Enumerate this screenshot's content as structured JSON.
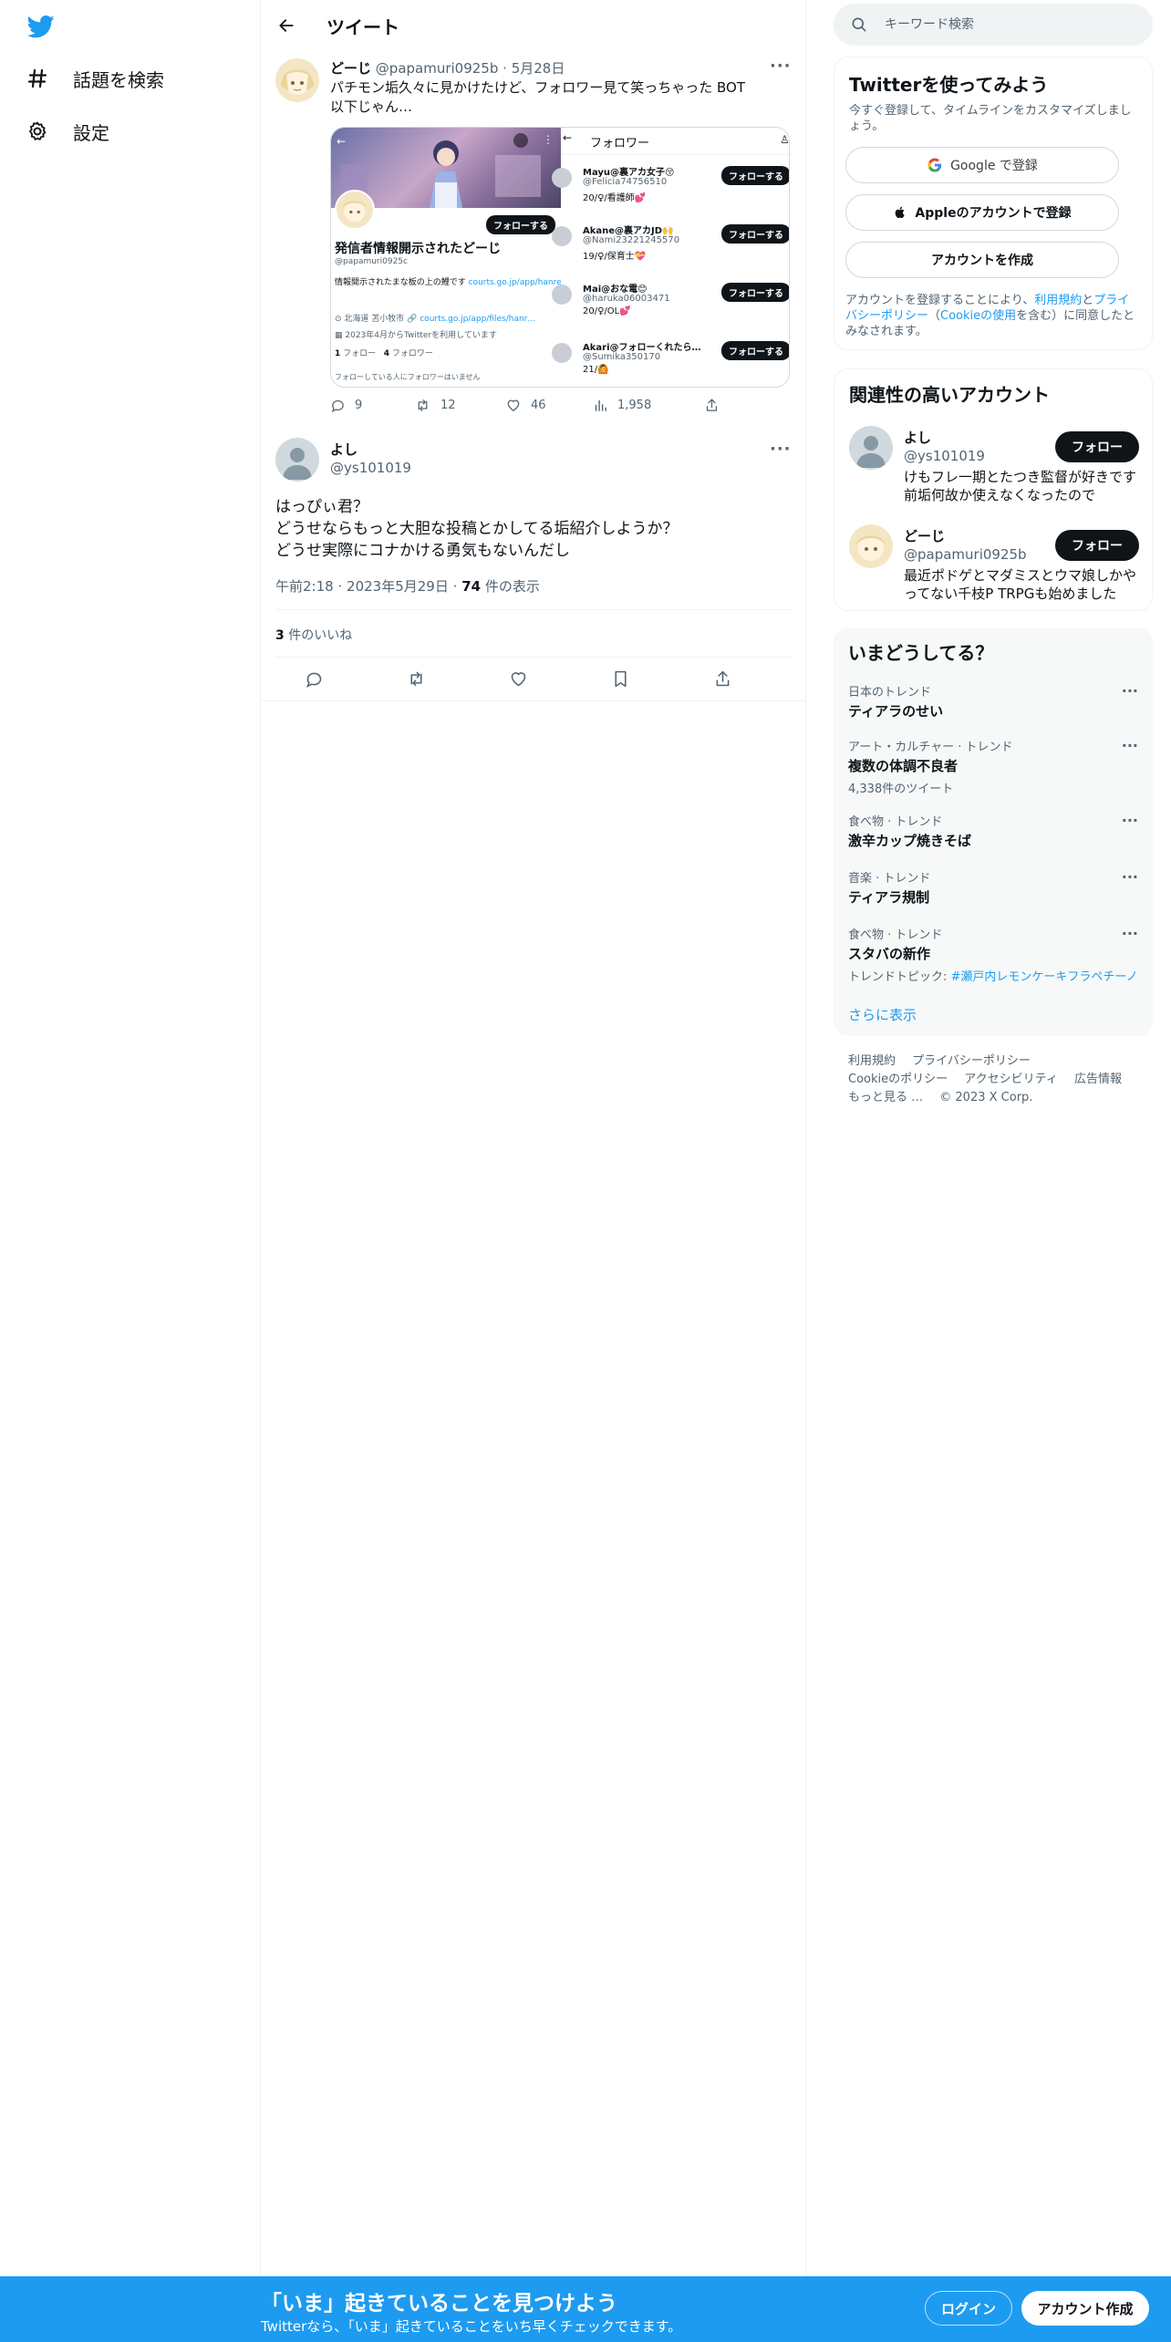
{
  "nav": {
    "explore_label": "話題を検索",
    "settings_label": "設定"
  },
  "header": {
    "title": "ツイート"
  },
  "quoted_tweet": {
    "name": "どーじ",
    "handle": "@papamuri0925b",
    "date": "5月28日",
    "text": "パチモン垢久々に見かけたけど、フォロワー見て笑っちゃった BOT以下じゃん…",
    "replies": "9",
    "retweets": "12",
    "likes": "46",
    "views": "1,958",
    "media": {
      "profile_follow_label": "フォローする",
      "profile_name": "発信者情報開示されたどーじ",
      "profile_handle": "@papamuri0925c",
      "profile_bio": "情報開示されたまな板の上の鯉です",
      "profile_bio_link": "courts.go.jp/app/hanrei_jp/…",
      "profile_location": "北海道 苫小牧市",
      "profile_url": "courts.go.jp/app/files/hanr…",
      "profile_joined": "2023年4月からTwitterを利用しています",
      "profile_following": "1",
      "profile_following_label": "フォロー",
      "profile_followers": "4",
      "profile_followers_label": "フォロワー",
      "profile_note": "フォローしている人にフォロワーはいません",
      "followers_header": "フォロワー",
      "followers": [
        {
          "name": "Mayu@裏アカ女子😚",
          "handle": "@Felicia74756510",
          "bio": "20/♀/看護師💕",
          "btn": "フォローする"
        },
        {
          "name": "Akane@裏アカJD🙌",
          "handle": "@Nami23221245570",
          "bio": "19/♀/保育士💝",
          "btn": "フォローする"
        },
        {
          "name": "Mai@おな電😊",
          "handle": "@haruka06003471",
          "bio": "20/♀/OL💕",
          "btn": "フォローする"
        },
        {
          "name": "Akari@フォローくれたら…",
          "handle": "@Sumika350170",
          "bio": "21/🙆",
          "btn": "フォローする"
        }
      ]
    }
  },
  "tweet": {
    "name": "よし",
    "handle": "@ys101019",
    "text": "はっぴぃ君？\nどうせならもっと大胆な投稿とかしてる垢紹介しようか？\nどうせ実際にコナかける勇気もないんだし",
    "time": "午前2:18",
    "date": "2023年5月29日",
    "views_count": "74",
    "views_label": "件の表示",
    "likes_count": "3",
    "likes_label": "件のいいね"
  },
  "search": {
    "placeholder": "キーワード検索"
  },
  "signup_card": {
    "title": "Twitterを使ってみよう",
    "subtitle": "今すぐ登録して、タイムラインをカスタマイズしましょう。",
    "google_label": "Google で登録",
    "apple_label": "Appleのアカウントで登録",
    "create_label": "アカウントを作成",
    "legal_prefix": "アカウントを登録することにより、",
    "legal_terms": "利用規約",
    "legal_and": "と",
    "legal_privacy": "プライバシーポリシー",
    "legal_open": "（",
    "legal_cookie": "Cookieの使用",
    "legal_suffix": "を含む）に同意したとみなされます。"
  },
  "relevant": {
    "title": "関連性の高いアカウント",
    "accounts": [
      {
        "name": "よし",
        "handle": "@ys101019",
        "bio": "けもフレ一期とたつき監督が好きです 前垢何故か使えなくなったので",
        "btn": "フォロー"
      },
      {
        "name": "どーじ",
        "handle": "@papamuri0925b",
        "bio": "最近ポドゲとマダミスとウマ娘しかやってない千枝P TRPGも始めました",
        "btn": "フォロー"
      }
    ]
  },
  "trends": {
    "title": "いまどうしてる？",
    "items": [
      {
        "context": "日本のトレンド",
        "title": "ティアラのせい"
      },
      {
        "context": "アート・カルチャー · トレンド",
        "title": "複数の体調不良者",
        "count": "4,338件のツイート"
      },
      {
        "context": "食べ物 · トレンド",
        "title": "激辛カップ焼きそば"
      },
      {
        "context": "音楽 · トレンド",
        "title": "ティアラ規制"
      },
      {
        "context": "食べ物 · トレンド",
        "title": "スタバの新作",
        "topic_label": "トレンドトピック: ",
        "topic": "#瀬戸内レモンケーキフラペチーノ"
      }
    ],
    "show_more": "さらに表示"
  },
  "footer": {
    "terms": "利用規約",
    "privacy": "プライバシーポリシー",
    "cookie": "Cookieのポリシー",
    "accessibility": "アクセシビリティ",
    "ads": "広告情報",
    "more": "もっと見る …",
    "copyright": "© 2023 X Corp."
  },
  "bottom_bar": {
    "title": "「いま」起きていることを見つけよう",
    "subtitle": "Twitterなら、「いま」起きていることをいち早くチェックできます。",
    "login": "ログイン",
    "signup": "アカウント作成"
  },
  "colors": {
    "accent": "#1d9bf0",
    "text": "#0f1419",
    "muted": "#536471"
  }
}
